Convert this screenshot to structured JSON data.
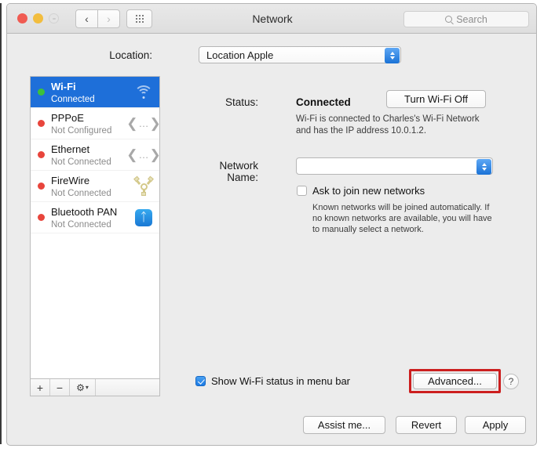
{
  "window": {
    "title": "Network",
    "controls": {
      "close": "close",
      "minimize": "minimize",
      "zoom": "zoom"
    },
    "nav": {
      "back": "‹",
      "forward": "›",
      "grid": "all-preferences"
    },
    "search": {
      "placeholder": "Search",
      "value": ""
    }
  },
  "location": {
    "label": "Location:",
    "value": "Location Apple"
  },
  "sidebar": {
    "items": [
      {
        "name": "Wi-Fi",
        "status": "Connected",
        "dot": "green",
        "icon": "wifi-icon",
        "selected": true
      },
      {
        "name": "PPPoE",
        "status": "Not Configured",
        "dot": "red",
        "icon": "wan-icon",
        "selected": false
      },
      {
        "name": "Ethernet",
        "status": "Not Connected",
        "dot": "red",
        "icon": "wan-icon",
        "selected": false
      },
      {
        "name": "FireWire",
        "status": "Not Connected",
        "dot": "red",
        "icon": "firewire-icon",
        "selected": false
      },
      {
        "name": "Bluetooth PAN",
        "status": "Not Connected",
        "dot": "red",
        "icon": "bluetooth-icon",
        "selected": false
      }
    ],
    "toolbar": {
      "add": "+",
      "remove": "−",
      "gear": "⚙",
      "gear_caret": "▾"
    }
  },
  "main": {
    "status_label": "Status:",
    "status_value": "Connected",
    "toggle_wifi_button": "Turn Wi-Fi Off",
    "status_description": "Wi-Fi is connected to Charles's Wi-Fi Network and has the IP address 10.0.1.2.",
    "network_name_label": "Network Name:",
    "network_name_value": "",
    "ask_join_label": "Ask to join new networks",
    "ask_join_checked": false,
    "ask_join_description": "Known networks will be joined automatically. If no known networks are available, you will have to manually select a network.",
    "show_status_label": "Show Wi-Fi status in menu bar",
    "show_status_checked": true,
    "advanced_button": "Advanced...",
    "help_button": "?",
    "assist_button": "Assist me...",
    "revert_button": "Revert",
    "apply_button": "Apply"
  },
  "colors": {
    "selection_blue": "#1e6fd9",
    "highlight_red": "#cc1f1f",
    "status_green": "#3cc13b",
    "status_red": "#e8453c",
    "accent_blue": "#1a78d4"
  }
}
